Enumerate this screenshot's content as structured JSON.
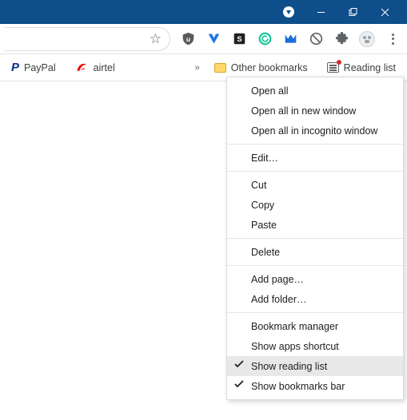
{
  "titlebar": {
    "dropdown": "window-dropdown",
    "minimize": "minimize",
    "maximize": "maximize",
    "close": "close"
  },
  "omnibox": {
    "star_title": "Bookmark this tab"
  },
  "extensions": [
    {
      "id": "ublock"
    },
    {
      "id": "v-ext"
    },
    {
      "id": "s-ext"
    },
    {
      "id": "grammarly"
    },
    {
      "id": "malwarebytes"
    },
    {
      "id": "noscript"
    },
    {
      "id": "extensions"
    },
    {
      "id": "profile"
    },
    {
      "id": "menu"
    }
  ],
  "bookmarks": {
    "paypal": "PayPal",
    "airtel": "airtel",
    "other": "Other bookmarks",
    "reading": "Reading list"
  },
  "ctx": {
    "open_all": "Open all",
    "open_all_new": "Open all in new window",
    "open_all_incog": "Open all in incognito window",
    "edit": "Edit…",
    "cut": "Cut",
    "copy": "Copy",
    "paste": "Paste",
    "delete": "Delete",
    "add_page": "Add page…",
    "add_folder": "Add folder…",
    "bm_manager": "Bookmark manager",
    "show_apps": "Show apps shortcut",
    "show_reading": "Show reading list",
    "show_bar": "Show bookmarks bar"
  }
}
